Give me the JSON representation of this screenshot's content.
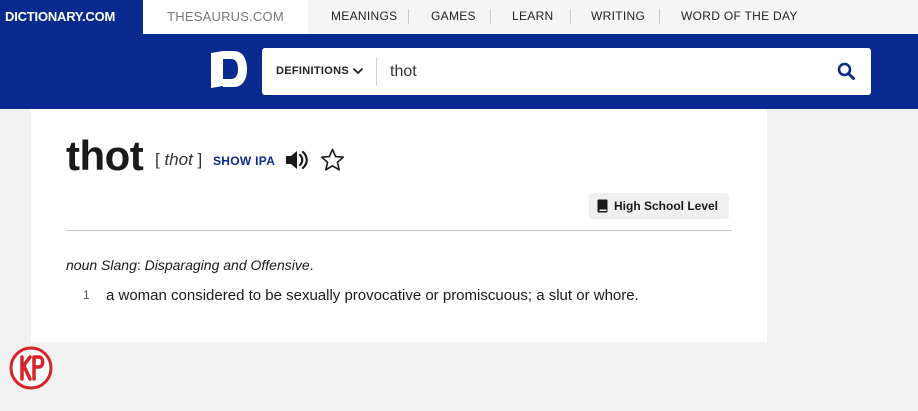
{
  "nav": {
    "brand": "DICTIONARY.COM",
    "thesaurus": "THESAURUS.COM",
    "items": [
      "MEANINGS",
      "GAMES",
      "LEARN",
      "WRITING",
      "WORD OF THE DAY"
    ]
  },
  "search": {
    "mode": "DEFINITIONS",
    "query": "thot"
  },
  "entry": {
    "word": "thot",
    "pron_open": "[ ",
    "pron_word": "thot",
    "pron_close": " ]",
    "show_ipa": "SHOW IPA",
    "level": "High School Level",
    "pos_line": {
      "pos": "noun",
      "label": " Slang",
      "colon": ": ",
      "usage": "Disparaging and Offensive",
      "period": "."
    },
    "definitions": [
      {
        "num": "1",
        "text": "a woman considered to be sexually provocative or promiscuous; a slut or whore."
      }
    ]
  },
  "watermark": {
    "text": "KP"
  },
  "colors": {
    "brand_blue": "#0a2a8f",
    "background": "#f1f1f1",
    "watermark_red": "#d6232a"
  }
}
